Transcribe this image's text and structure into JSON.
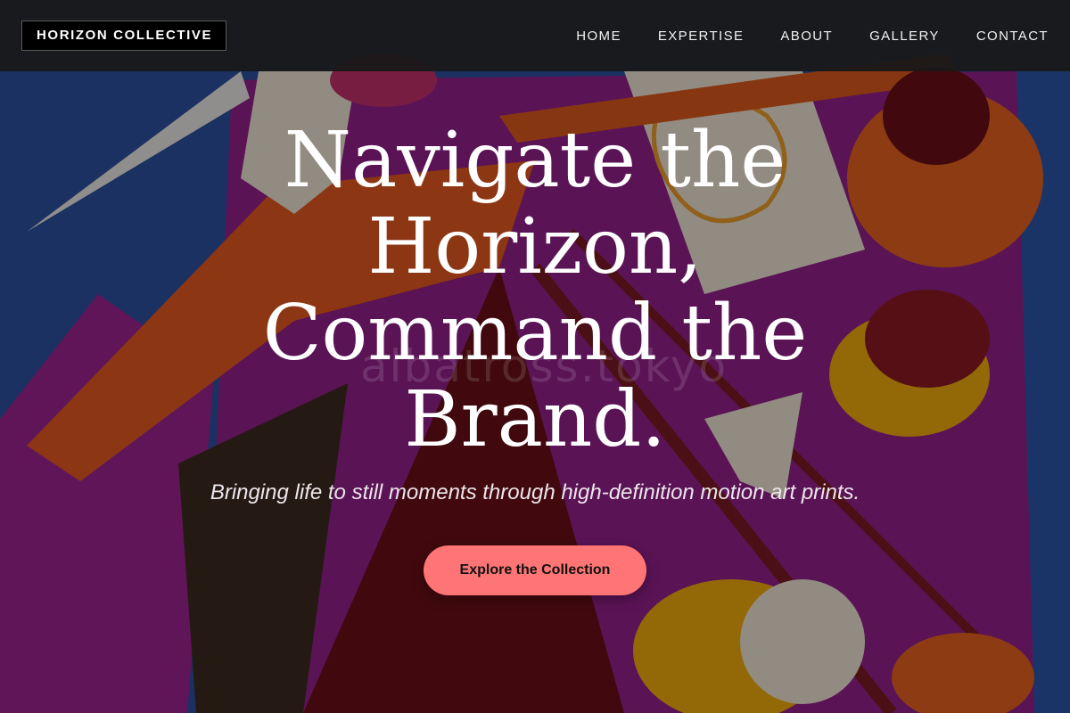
{
  "brand": {
    "logo_text": "HORIZON COLLECTIVE"
  },
  "nav": {
    "items": [
      {
        "label": "HOME"
      },
      {
        "label": "EXPERTISE"
      },
      {
        "label": "ABOUT"
      },
      {
        "label": "GALLERY"
      },
      {
        "label": "CONTACT"
      }
    ]
  },
  "hero": {
    "headline_lines": [
      "Navigate the",
      "Horizon,",
      "Command the",
      "Brand."
    ],
    "tagline": "Bringing life to still moments through high-definition motion art prints.",
    "cta_label": "Explore the Collection",
    "watermark": "albatross.tokyo"
  },
  "colors": {
    "cta_background": "#ff7474",
    "navbar_background": "#181818",
    "art_blue": "#2a4f9e",
    "art_magenta": "#8f1f86",
    "art_orange": "#e2571f",
    "art_dark_red": "#6a1018",
    "art_yellow": "#eea80c",
    "art_cream": "#ece1d0"
  },
  "icons": {
    "artwork": "abstract-painting-background"
  }
}
